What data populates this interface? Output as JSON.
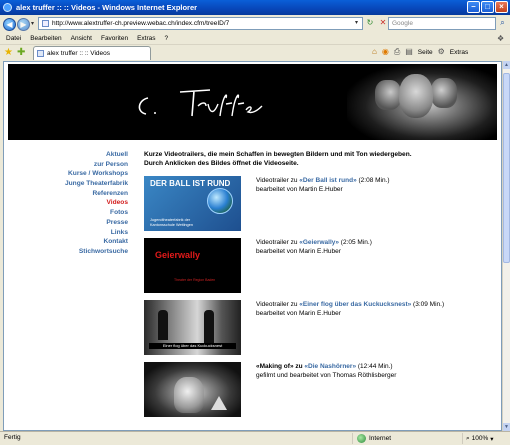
{
  "window": {
    "title": "alex truffer :: :: Videos - Windows Internet Explorer",
    "minimize": "–",
    "maximize": "□",
    "close": "×"
  },
  "address_bar": {
    "url": "http://www.alextruffer-ch.preview.webac.ch/index.cfm/treeID/7",
    "search_placeholder": "Google"
  },
  "menu": [
    "Datei",
    "Bearbeiten",
    "Ansicht",
    "Favoriten",
    "Extras",
    "?"
  ],
  "tab": {
    "label": "alex truffer :: :: Videos"
  },
  "command_bar": {
    "page_label": "Seite",
    "tools_label": "Extras"
  },
  "page": {
    "nav": [
      {
        "label": "Aktuell",
        "active": false
      },
      {
        "label": "zur Person",
        "active": false
      },
      {
        "label": "Kurse / Workshops",
        "active": false
      },
      {
        "label": "Junge Theaterfabrik",
        "active": false
      },
      {
        "label": "Referenzen",
        "active": false
      },
      {
        "label": "Videos",
        "active": true
      },
      {
        "label": "Fotos",
        "active": false
      },
      {
        "label": "Presse",
        "active": false
      },
      {
        "label": "Links",
        "active": false
      },
      {
        "label": "Kontakt",
        "active": false
      },
      {
        "label": "Stichwortsuche",
        "active": false
      }
    ],
    "intro_line1": "Kurze Videotrailers, die mein Schaffen in bewegten Bildern und mit Ton wiedergeben.",
    "intro_line2": "Durch Anklicken des Bildes öffnet die Videoseite.",
    "videos": [
      {
        "prefix": "Videotrailer zu ",
        "title": "«Der Ball ist rund»",
        "duration": " (2:08 Min.)",
        "credit": "bearbeitet von Martin E.Huber",
        "thumb_title": "DER BALL IST RUND",
        "thumb_sub": "Jugendtheaterfabrik der Kantonsschule Wettingen"
      },
      {
        "prefix": "Videotrailer zu ",
        "title": "«Geierwally»",
        "duration": " (2:05 Min.)",
        "credit": "bearbeitet von Marin E.Huber",
        "thumb_title": "Geierwally",
        "thumb_sub": "Theater der Region Baden"
      },
      {
        "prefix": "Videotrailer zu ",
        "title": "«Einer flog über das Kuckucksnest»",
        "duration": " (3:09 Min.)",
        "credit": "bearbeitet von Marin E.Huber",
        "thumb_caption": "Einer flog über das Kuckucksnest"
      },
      {
        "prefix": "«Making of» zu ",
        "title": "«Die Nashörner»",
        "duration": " (12:44 Min.)",
        "credit": "gefilmt und bearbeitet von Thomas Röthlisberger"
      }
    ]
  },
  "status_bar": {
    "text": "Fertig",
    "zone": "Internet",
    "zoom": "100%"
  }
}
